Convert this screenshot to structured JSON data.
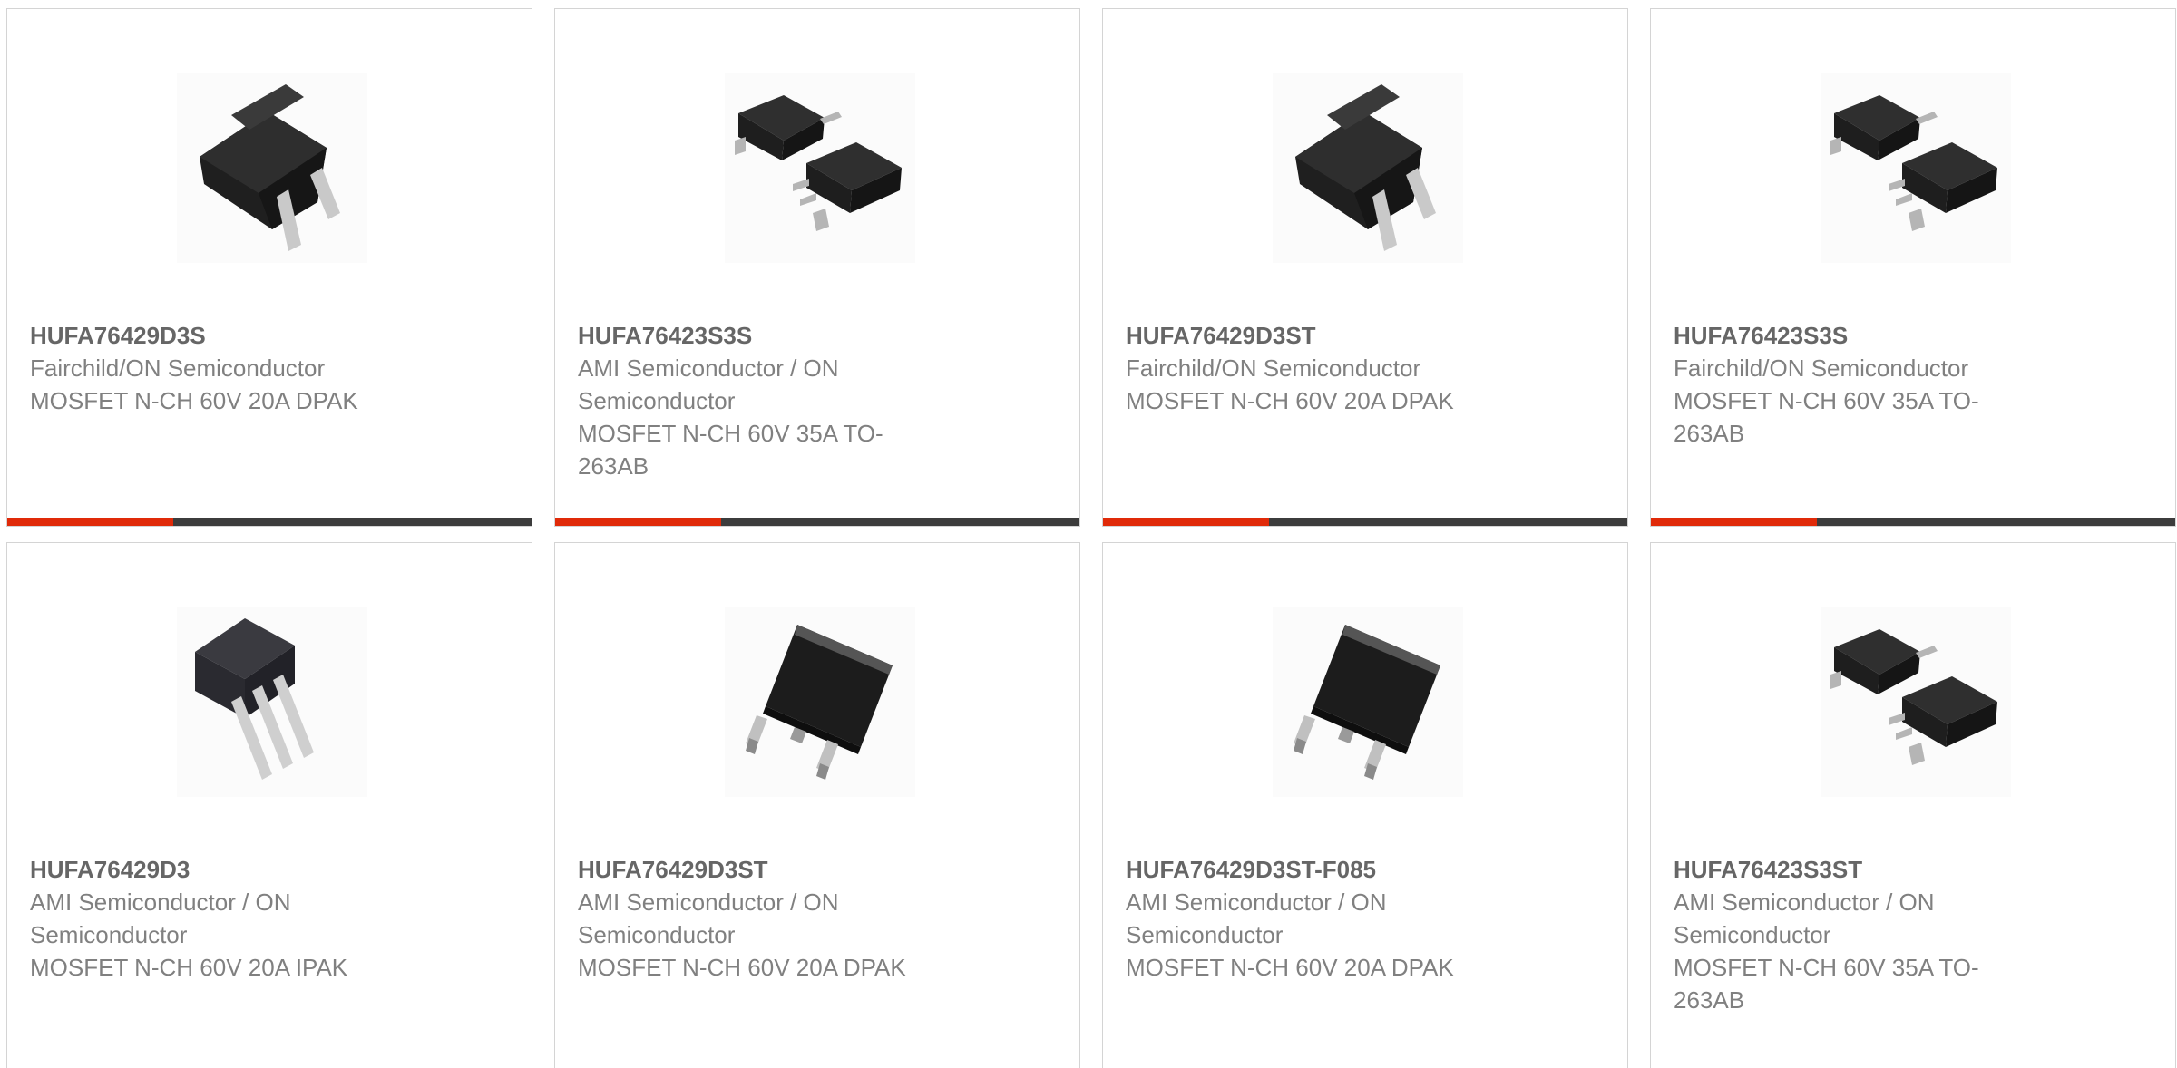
{
  "products": [
    {
      "part_number": "HUFA76429D3S",
      "manufacturer": "Fairchild/ON Semiconductor",
      "description": "MOSFET N-CH 60V 20A DPAK",
      "package_icon": "dpak-icon"
    },
    {
      "part_number": "HUFA76423S3S",
      "manufacturer": "AMI Semiconductor / ON Semiconductor",
      "description": "MOSFET N-CH 60V 35A TO-263AB",
      "package_icon": "d2pak-pair-icon"
    },
    {
      "part_number": "HUFA76429D3ST",
      "manufacturer": "Fairchild/ON Semiconductor",
      "description": "MOSFET N-CH 60V 20A DPAK",
      "package_icon": "dpak-icon"
    },
    {
      "part_number": "HUFA76423S3S",
      "manufacturer": "Fairchild/ON Semiconductor",
      "description": "MOSFET N-CH 60V 35A TO-263AB",
      "package_icon": "d2pak-pair-icon"
    },
    {
      "part_number": "HUFA76429D3",
      "manufacturer": "AMI Semiconductor / ON Semiconductor",
      "description": "MOSFET N-CH 60V 20A IPAK",
      "package_icon": "ipak-icon"
    },
    {
      "part_number": "HUFA76429D3ST",
      "manufacturer": "AMI Semiconductor / ON Semiconductor",
      "description": "MOSFET N-CH 60V 20A DPAK",
      "package_icon": "dpak-tilted-icon"
    },
    {
      "part_number": "HUFA76429D3ST-F085",
      "manufacturer": "AMI Semiconductor / ON Semiconductor",
      "description": "MOSFET N-CH 60V 20A DPAK",
      "package_icon": "dpak-tilted-icon"
    },
    {
      "part_number": "HUFA76423S3ST",
      "manufacturer": "AMI Semiconductor / ON Semiconductor",
      "description": "MOSFET N-CH 60V 35A TO-263AB",
      "package_icon": "d2pak-pair-icon"
    }
  ],
  "colors": {
    "accent": "#e02a09",
    "bar_dark": "#3c3c3c",
    "border": "#d4d4d4",
    "part_number": "#666666",
    "body_text": "#808080"
  }
}
